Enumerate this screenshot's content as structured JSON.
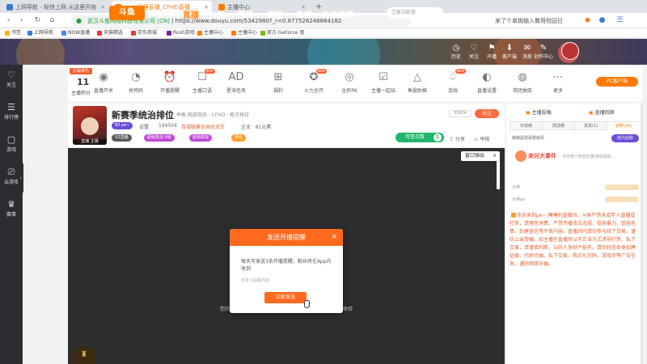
{
  "browser": {
    "tabs": [
      {
        "label": "上网导航 - 轻快上网 从这里开始",
        "color": "#3a7bd5",
        "active": false
      },
      {
        "label": "pe~ 睡睡直播_CFHD直播_斗鱼直播",
        "color": "#ff7a00",
        "active": true
      },
      {
        "label": "主播中心",
        "color": "#ff7a00",
        "active": false
      }
    ],
    "tab_close": "×",
    "new_tab": "+",
    "nav": {
      "back": "‹",
      "forward": "›",
      "reload": "↻",
      "home": "⌂"
    },
    "url": "https://www.douyu.com/5342980?_r=0.877526246864182",
    "url_prefix": "武汉斗鱼网络科技有限公司 [CN]",
    "search_suggestion": "来了个单挑输入撒哥校园日",
    "bookmarks": [
      {
        "label": "书签",
        "color": "#f4b400"
      },
      {
        "label": "上网导航",
        "color": "#3a7bd5"
      },
      {
        "label": "NOW直播",
        "color": "#4285f4"
      },
      {
        "label": "天猫精选",
        "color": "#e53935"
      },
      {
        "label": "京东商城",
        "color": "#e53935"
      },
      {
        "label": "Rush游戏",
        "color": "#7b1fa2"
      },
      {
        "label": "主播中心",
        "color": "#ff7a00"
      },
      {
        "label": "主播中心",
        "color": "#ff7a00"
      },
      {
        "label": "官方 GeForce 驱",
        "color": "#76b900"
      }
    ]
  },
  "site": {
    "logo": "斗鱼",
    "nav": [
      "首页",
      "直播",
      "分类",
      "视频",
      "游戏",
      "鱼吧",
      "鱼乐盛典"
    ],
    "search_placeholder": "卫客训练营",
    "icons": [
      {
        "label": "历史",
        "glyph": "◷"
      },
      {
        "label": "关注",
        "glyph": "♡"
      },
      {
        "label": "开播",
        "glyph": "⚑"
      },
      {
        "label": "客户端",
        "glyph": "⬇"
      },
      {
        "label": "消息",
        "glyph": "✉"
      },
      {
        "label": "创作中心",
        "glyph": "✎"
      }
    ]
  },
  "leftrail": [
    {
      "label": "关注",
      "glyph": "♡"
    },
    {
      "label": "排行榜",
      "glyph": "☰"
    },
    {
      "label": "游戏",
      "glyph": "▢"
    },
    {
      "label": "云游戏",
      "glyph": "⎚"
    },
    {
      "label": "赛事",
      "glyph": "♛"
    }
  ],
  "funcbar": {
    "rank_tag": "历届排名",
    "rank_num": "11",
    "rank_label": "主播积分",
    "items": [
      {
        "label": "直播开关",
        "glyph": "◉",
        "new": false
      },
      {
        "label": "抢鸡码",
        "glyph": "◔",
        "new": false
      },
      {
        "label": "开播提醒",
        "glyph": "⏰",
        "new": false
      },
      {
        "label": "主播口语",
        "glyph": "☐",
        "new": true
      },
      {
        "label": "星海任务",
        "glyph": "AD",
        "new": false
      },
      {
        "label": "福利",
        "glyph": "⊞",
        "new": false
      },
      {
        "label": "火力全开",
        "glyph": "✪",
        "new": true
      },
      {
        "label": "全民PK",
        "glyph": "◎",
        "new": false
      },
      {
        "label": "主播一起玩",
        "glyph": "☑",
        "new": false
      },
      {
        "label": "鱼翅助推",
        "glyph": "△",
        "new": false
      },
      {
        "label": "连线",
        "glyph": "♤",
        "new": true
      },
      {
        "label": "直播设置",
        "glyph": "◐",
        "new": false
      },
      {
        "label": "带团抽奖",
        "glyph": "◍",
        "new": false
      },
      {
        "label": "更多",
        "glyph": "⋯",
        "new": false
      }
    ],
    "new_tag": "NEW",
    "pc_client": "PC客户端"
  },
  "room": {
    "avatar_label": "直播 主播",
    "title": "新赛季统治排位",
    "category": "举报   网游竞技 · CFHD · 枪王排位",
    "badges": [
      {
        "text": "60 pe~",
        "color": "#6d4cd6"
      },
      {
        "text": "V2直播",
        "color": "#5a5a5a"
      },
      {
        "text": "超级挑战 4级",
        "color": "#c04ad6"
      },
      {
        "text": "超级联盟",
        "color": "#c04ad6"
      },
      {
        "text": "排名",
        "color": "#ff9a2a"
      }
    ],
    "meta": [
      "设置",
      "194504",
      "百城联赛全国总冠军",
      "企业 · 81元素"
    ],
    "count": "32924",
    "follow": "关注",
    "yuwan_label": "可签次数",
    "yuwan_count": "1",
    "share": "分享",
    "report": "举报"
  },
  "player": {
    "pip": "窗口弹出",
    "pip_close": "×",
    "left_text": "您的",
    "right_text": "体验",
    "logo_glyph": "♜"
  },
  "dialog": {
    "title": "发送开播提醒",
    "close": "×",
    "text": "每天可发送3条开播提醒，粉丝将在App内收到",
    "input_placeholder": "自定义提醒内容",
    "send": "立即发送"
  },
  "right": {
    "tabs": [
      "主播投稿",
      "直播回顾"
    ],
    "subtabs": [
      "日流榜",
      "周流榜",
      "贵宾(1)",
      "钻粉(24)"
    ],
    "hint": "做做屋观看剧级票",
    "dream_btn": "成为钻粉",
    "event_title": "来问大事件",
    "event_desc": "今日有个粉丝比赛活动成绩...",
    "users": [
      "大捧",
      "大捧pe"
    ],
    "notice": "欢迎来到pe~ 睡睡的直播间。斗鱼严禁未成年人直播或打赏，请理性消费，严禁传播违法违规、低俗暴力、低俗色情、封建迷信等不良内容。直播间内请勿参与线下交易，谨防上当受骗。如主播在直播时以不正当方式诱导打赏、私下交易，请谨慎判断，以防人身财产损失。请勿轻信各类招聘征婚、代练代抽、私下交易、购买礼包码、游戏币等广告信息，谨防网络诈骗。"
  },
  "colors": {
    "accent": "#ff7a00",
    "dialog": "#ff6a1f",
    "green": "#1fb66a",
    "purple": "#6d4cd6"
  }
}
